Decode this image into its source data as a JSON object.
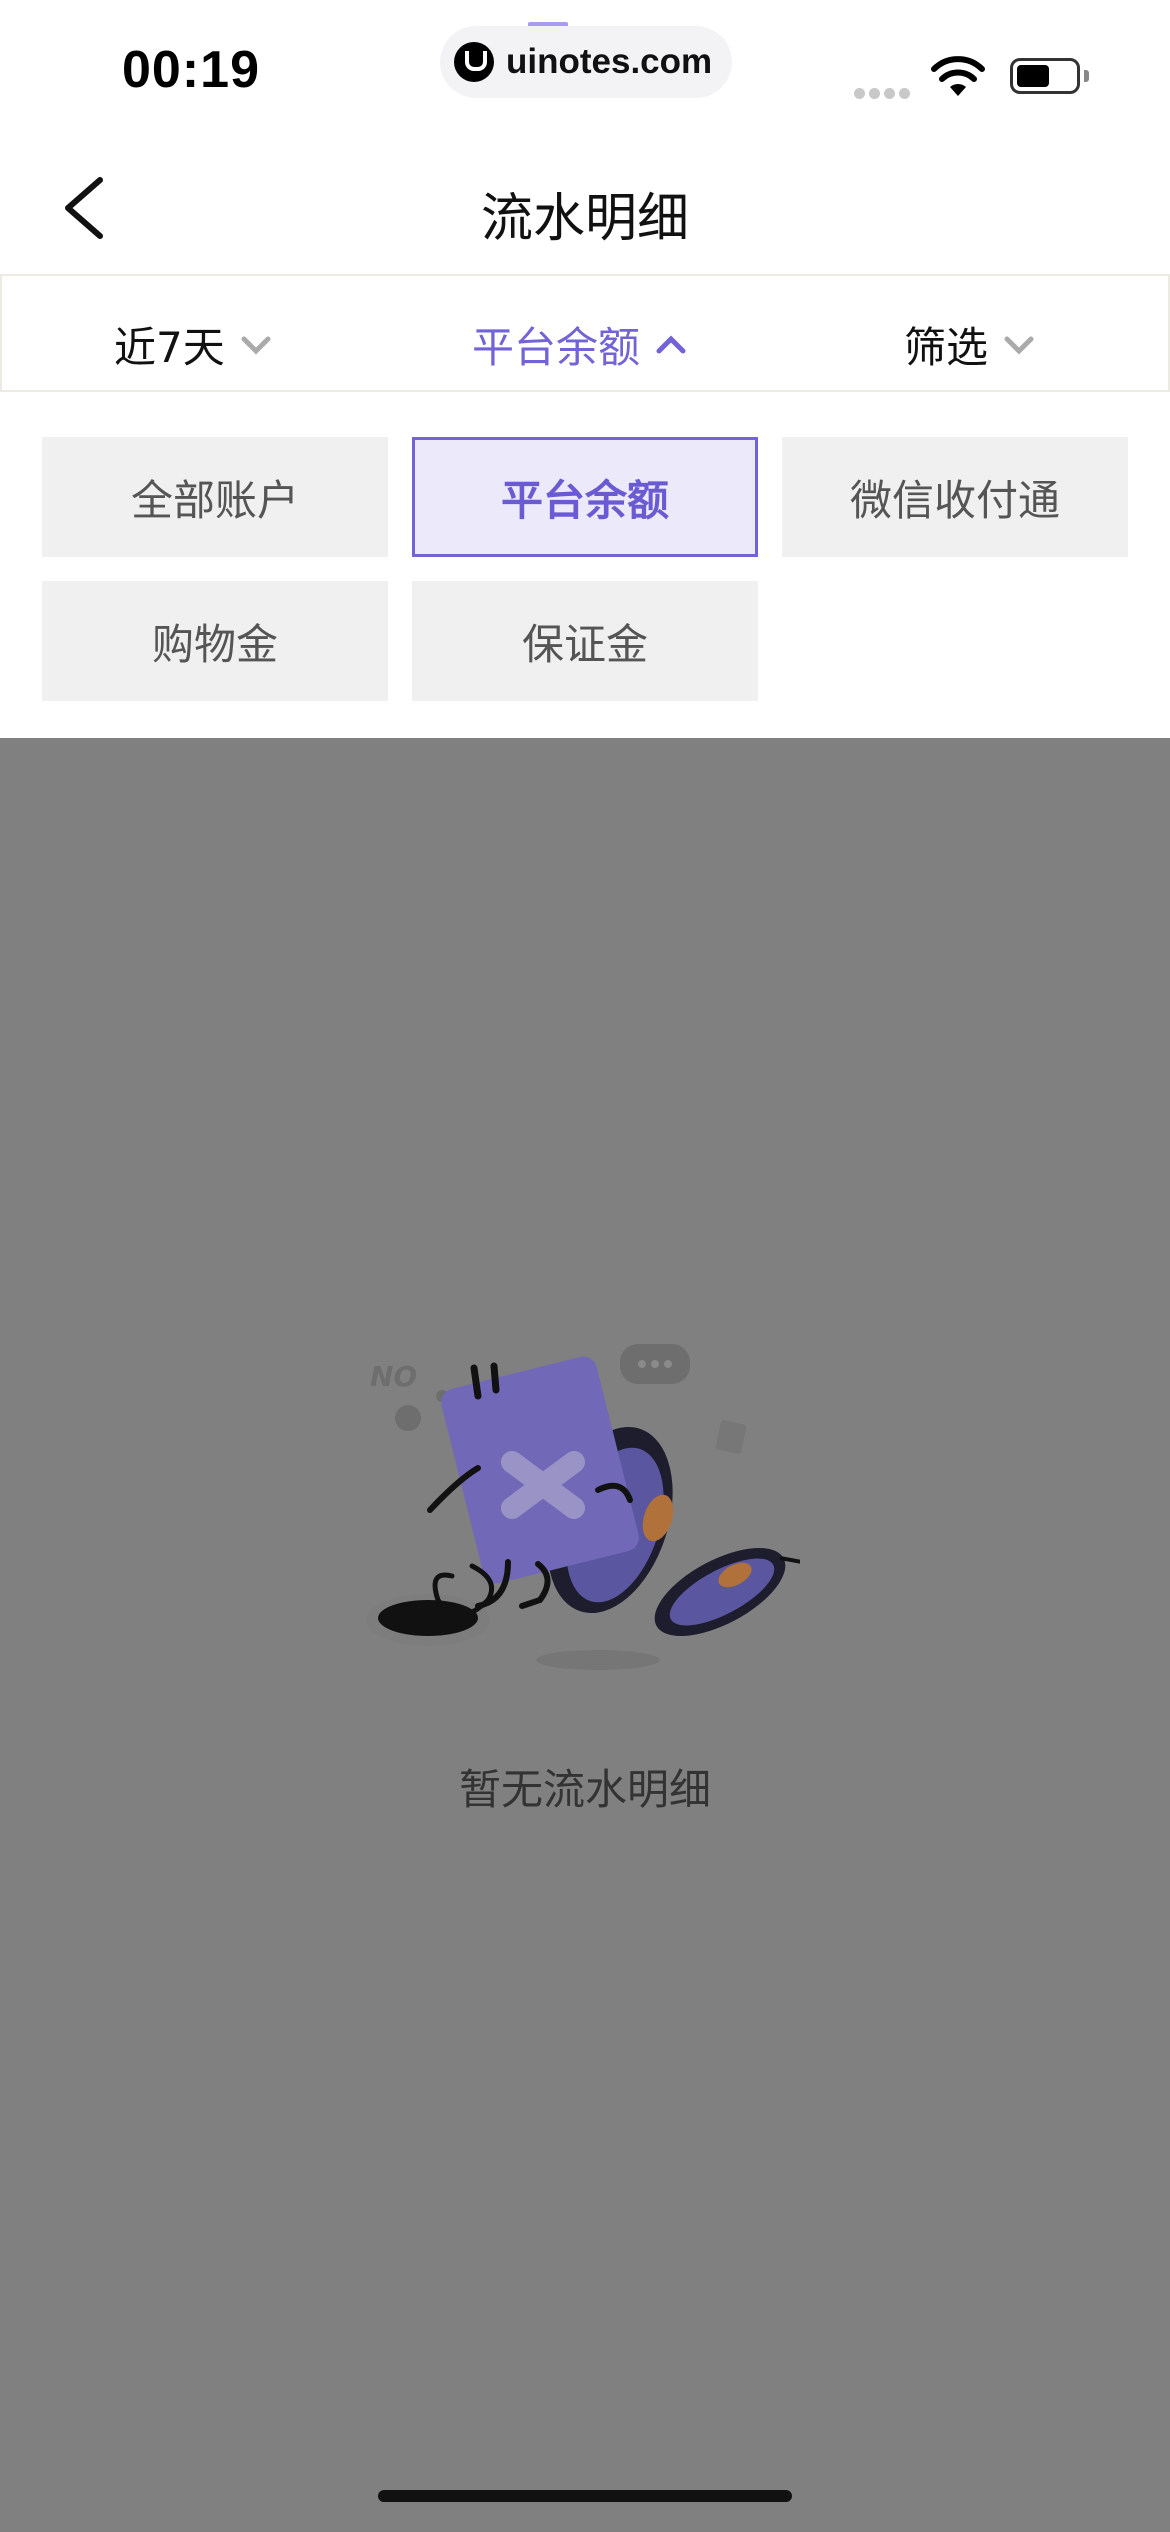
{
  "status_bar": {
    "time": "00:19",
    "url": "uinotes.com"
  },
  "nav": {
    "title": "流水明细"
  },
  "filters": {
    "period": "近7天",
    "account": "平台余额",
    "filter": "筛选"
  },
  "accounts": {
    "options": [
      "全部账户",
      "平台余额",
      "微信收付通",
      "购物金",
      "保证金"
    ],
    "selected": "平台余额"
  },
  "empty_state": {
    "message": "暂无流水明细",
    "illustration_text": "NO"
  },
  "colors": {
    "accent": "#7263d6",
    "overlay": "#808080"
  }
}
